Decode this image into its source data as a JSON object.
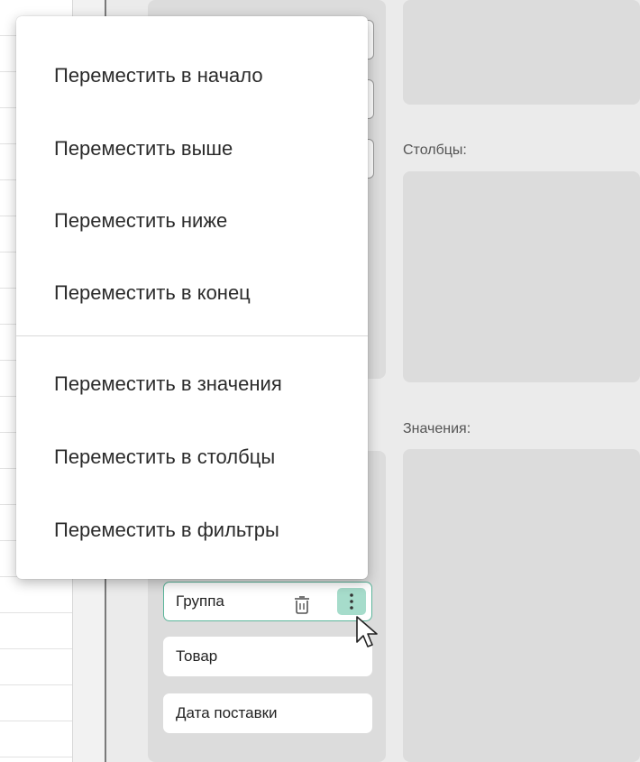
{
  "context_menu": {
    "items_group1": [
      {
        "label": "Переместить в начало"
      },
      {
        "label": "Переместить выше"
      },
      {
        "label": "Переместить ниже"
      },
      {
        "label": "Переместить в конец"
      }
    ],
    "items_group2": [
      {
        "label": "Переместить в значения"
      },
      {
        "label": "Переместить в столбцы"
      },
      {
        "label": "Переместить в фильтры"
      }
    ]
  },
  "zones": {
    "columns_label": "Столбцы:",
    "values_label": "Значения:"
  },
  "rows_fields": [
    {
      "label": "Группа"
    },
    {
      "label": "Товар"
    },
    {
      "label": "Дата поставки"
    }
  ],
  "icons": {
    "trash": "trash-icon",
    "more": "more-vertical-icon",
    "cursor": "mouse-pointer-icon"
  },
  "colors": {
    "accent": "#5bb59a",
    "accent_light": "#a6dccb"
  }
}
